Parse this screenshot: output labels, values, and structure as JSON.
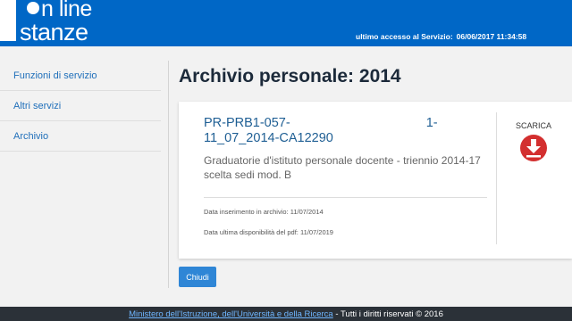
{
  "header": {
    "logo_line1": "n line",
    "logo_line2": "stanze",
    "last_access_label": "ultimo accesso al Servizio:",
    "last_access_value": "06/06/2017 11:34:58"
  },
  "sidebar": {
    "items": [
      {
        "label": "Funzioni di servizio"
      },
      {
        "label": "Altri servizi"
      },
      {
        "label": "Archivio"
      }
    ]
  },
  "main": {
    "title": "Archivio personale: 2014",
    "document": {
      "code_start": "PR-PRB1-057-",
      "code_mid": "1-",
      "code_end": "11_07_2014-CA12290",
      "description": "Graduatorie d'istituto personale docente - triennio 2014-17 scelta sedi mod. B",
      "inserted": "Data inserimento in archivio: 11/07/2014",
      "availability": "Data ultima disponibilità del pdf: 11/07/2019",
      "download_label": "SCARICA",
      "download_icon": "download-icon",
      "download_color": "#d32f2f"
    },
    "close_label": "Chiudi"
  },
  "footer": {
    "link": "Ministero dell'Istruzione, dell'Università e della Ricerca",
    "rights": "- Tutti i diritti riservati © 2016"
  }
}
